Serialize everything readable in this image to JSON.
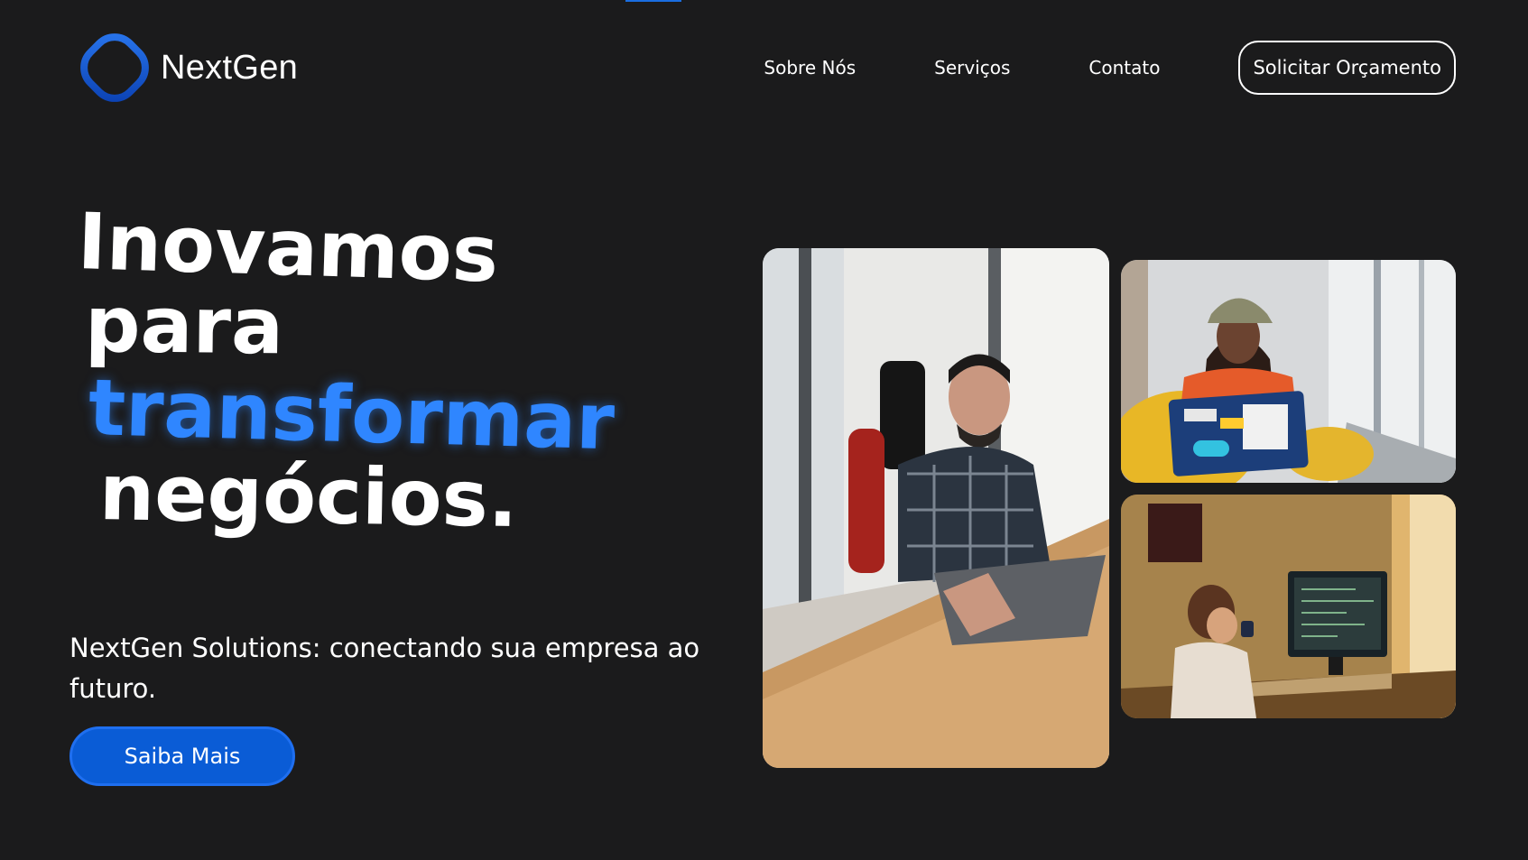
{
  "brand": {
    "name": "NextGen",
    "accent_color": "#1a5bd8"
  },
  "nav": {
    "items": [
      {
        "label": "Sobre Nós"
      },
      {
        "label": "Serviços"
      },
      {
        "label": "Contato"
      }
    ],
    "cta_label": "Solicitar Orçamento"
  },
  "hero": {
    "title_lines": [
      "Inovamos",
      "para",
      "transformar",
      "negócios."
    ],
    "highlight_color": "#2f86ff",
    "subtitle": "NextGen Solutions: conectando sua empresa ao futuro.",
    "button_label": "Saiba Mais",
    "button_color": "#0a5cd6"
  },
  "gallery": {
    "images": [
      {
        "subject": "man-with-laptop-at-wooden-desk"
      },
      {
        "subject": "woman-with-cap-using-laptop-with-stickers"
      },
      {
        "subject": "boy-drinking-at-computer-desk"
      }
    ]
  },
  "colors": {
    "background": "#1b1b1c",
    "text": "#ffffff"
  }
}
